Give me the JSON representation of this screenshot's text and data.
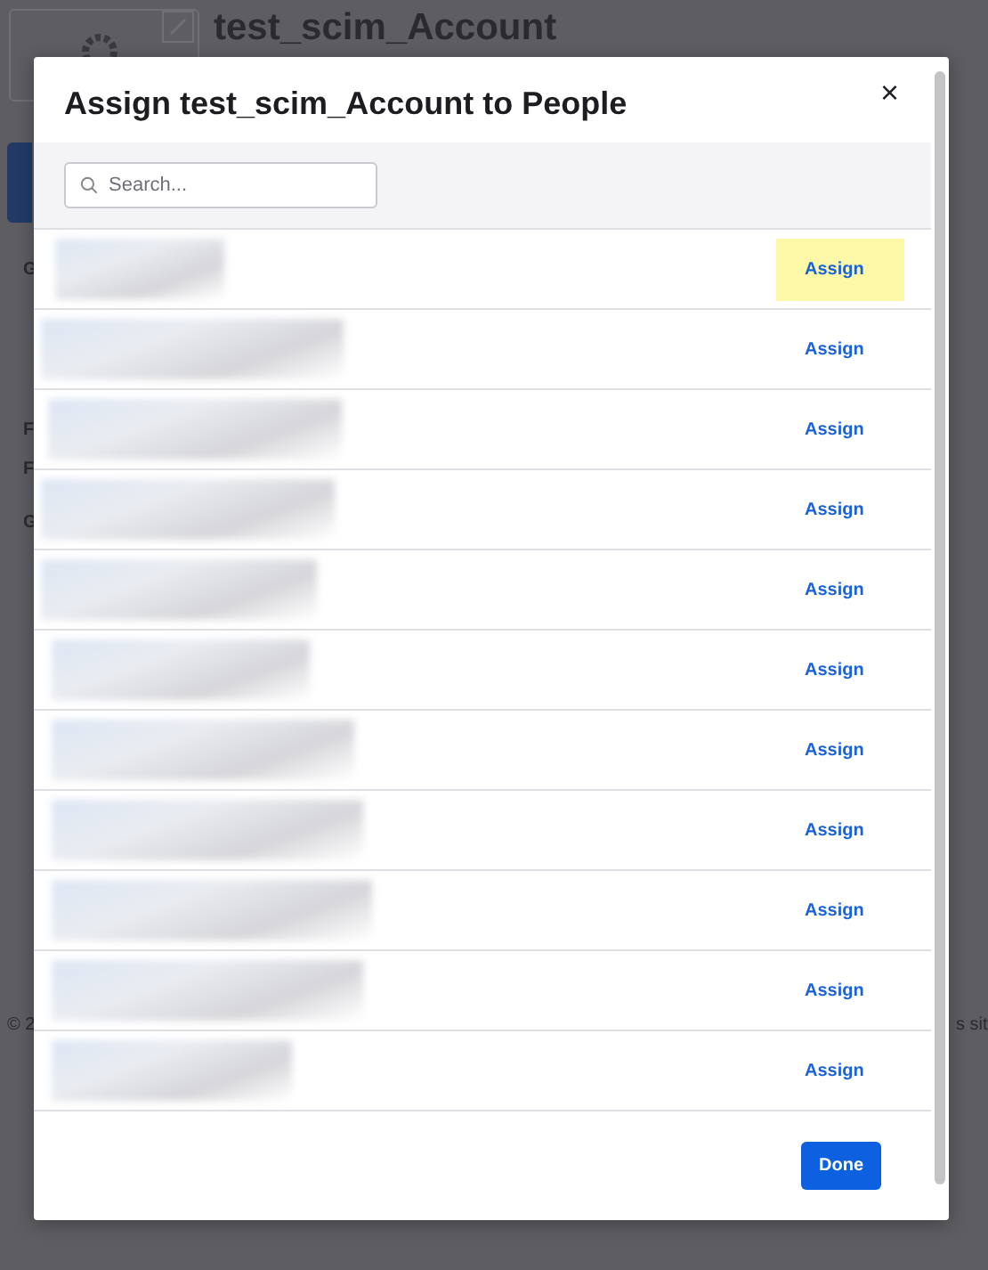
{
  "background_page": {
    "app_title": "test_scim_Account",
    "fragments": [
      "G",
      "F",
      "F",
      "G"
    ],
    "footer_left": "© 2",
    "footer_right": "s sit"
  },
  "dialog": {
    "title": "Assign test_scim_Account to People",
    "close": "×",
    "search": {
      "placeholder": "Search..."
    },
    "rows": [
      {
        "action": "Assign",
        "highlighted": true
      },
      {
        "action": "Assign",
        "highlighted": false
      },
      {
        "action": "Assign",
        "highlighted": false
      },
      {
        "action": "Assign",
        "highlighted": false
      },
      {
        "action": "Assign",
        "highlighted": false
      },
      {
        "action": "Assign",
        "highlighted": false
      },
      {
        "action": "Assign",
        "highlighted": false
      },
      {
        "action": "Assign",
        "highlighted": false
      },
      {
        "action": "Assign",
        "highlighted": false
      },
      {
        "action": "Assign",
        "highlighted": false
      },
      {
        "action": "Assign",
        "highlighted": false
      }
    ],
    "done": "Done"
  }
}
